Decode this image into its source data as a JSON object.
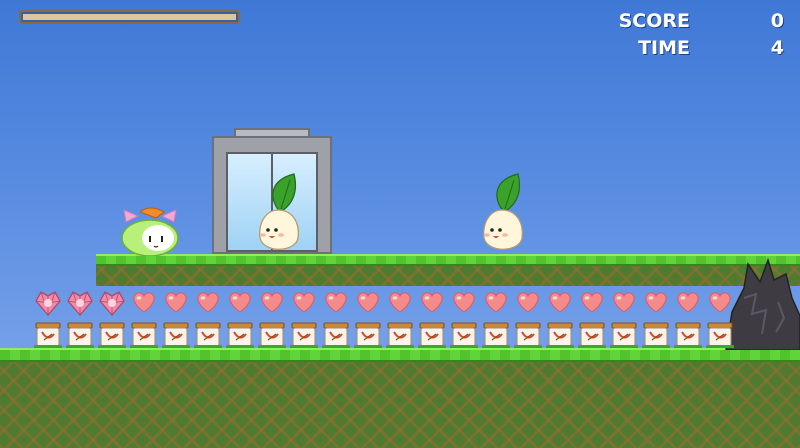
{
  "hud": {
    "score_label": "SCORE",
    "score_value": "0",
    "time_label": "TIME",
    "time_value": "4",
    "hp_fill_fraction": 0.98
  },
  "icons": {
    "player": "green-blob-cat-icon",
    "enemy": "leaf-radish-icon",
    "exit": "glass-door-icon",
    "gem": "pink-crystal-heart-icon",
    "heart": "heart-icon",
    "jar": "jam-jar-icon",
    "obstacle": "dark-rock-icon"
  },
  "counts": {
    "gems": 3,
    "hearts": 19,
    "jars": 22
  },
  "colors": {
    "sky": "#4f84dc",
    "grass": "#56c830",
    "dirt": "#4f7a2f",
    "heart": "#f48a8a",
    "player_body": "#b7f07a",
    "player_ears": "#f3a6d8",
    "radish_body": "#fff6dc",
    "radish_leaf": "#3aa12a"
  }
}
